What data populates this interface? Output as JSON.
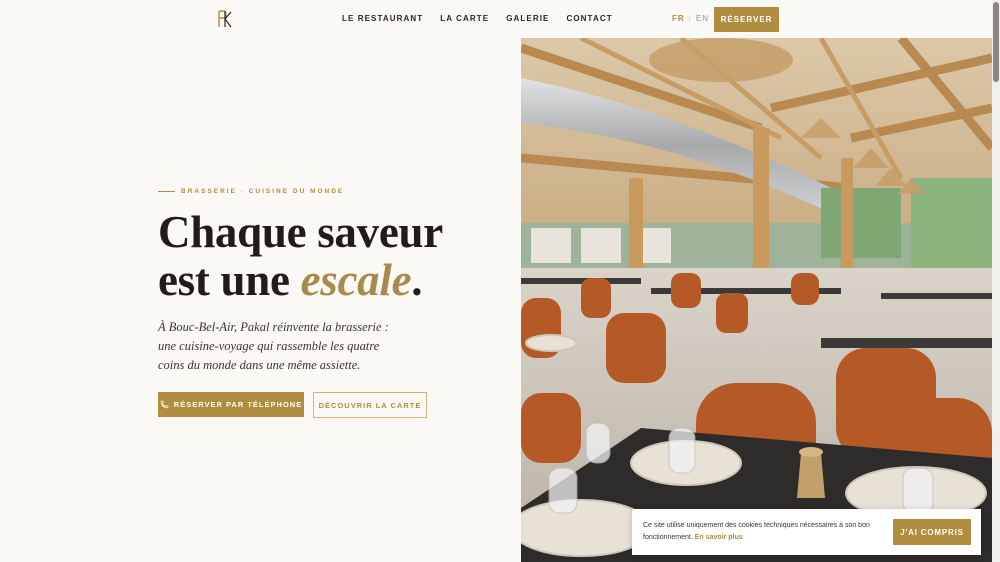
{
  "header": {
    "logo_text": "PK",
    "nav": [
      "LE RESTAURANT",
      "LA CARTE",
      "GALERIE",
      "CONTACT"
    ],
    "lang_active": "FR",
    "lang_separator": "/",
    "lang_other": "EN",
    "reserve_label": "RÉSERVER"
  },
  "hero": {
    "eyebrow": "BRASSERIE · CUISINE DU MONDE",
    "headline_line1": "Chaque saveur",
    "headline_line2_prefix": "est une ",
    "headline_accent": "escale",
    "headline_suffix": ".",
    "lead": "À Bouc-Bel-Air, Pakal réinvente la brasserie : une cuisine-voyage qui rassemble les quatre coins du monde dans une même assiette.",
    "primary_button": "RÉSERVER PAR TÉLÉPHONE",
    "secondary_button": "DÉCOUVRIR LA CARTE",
    "image_alt": "restaurant-interior-photo"
  },
  "cookie": {
    "message": "Ce site utilise uniquement des cookies techniques nécessaires à son bon fonctionnement.",
    "link": "En savoir plus",
    "button": "J'AI COMPRIS"
  },
  "colors": {
    "accent": "#b08d3f",
    "background": "#fbf9f6",
    "text": "#1f1c19"
  },
  "icons": {
    "phone": "phone-icon"
  }
}
